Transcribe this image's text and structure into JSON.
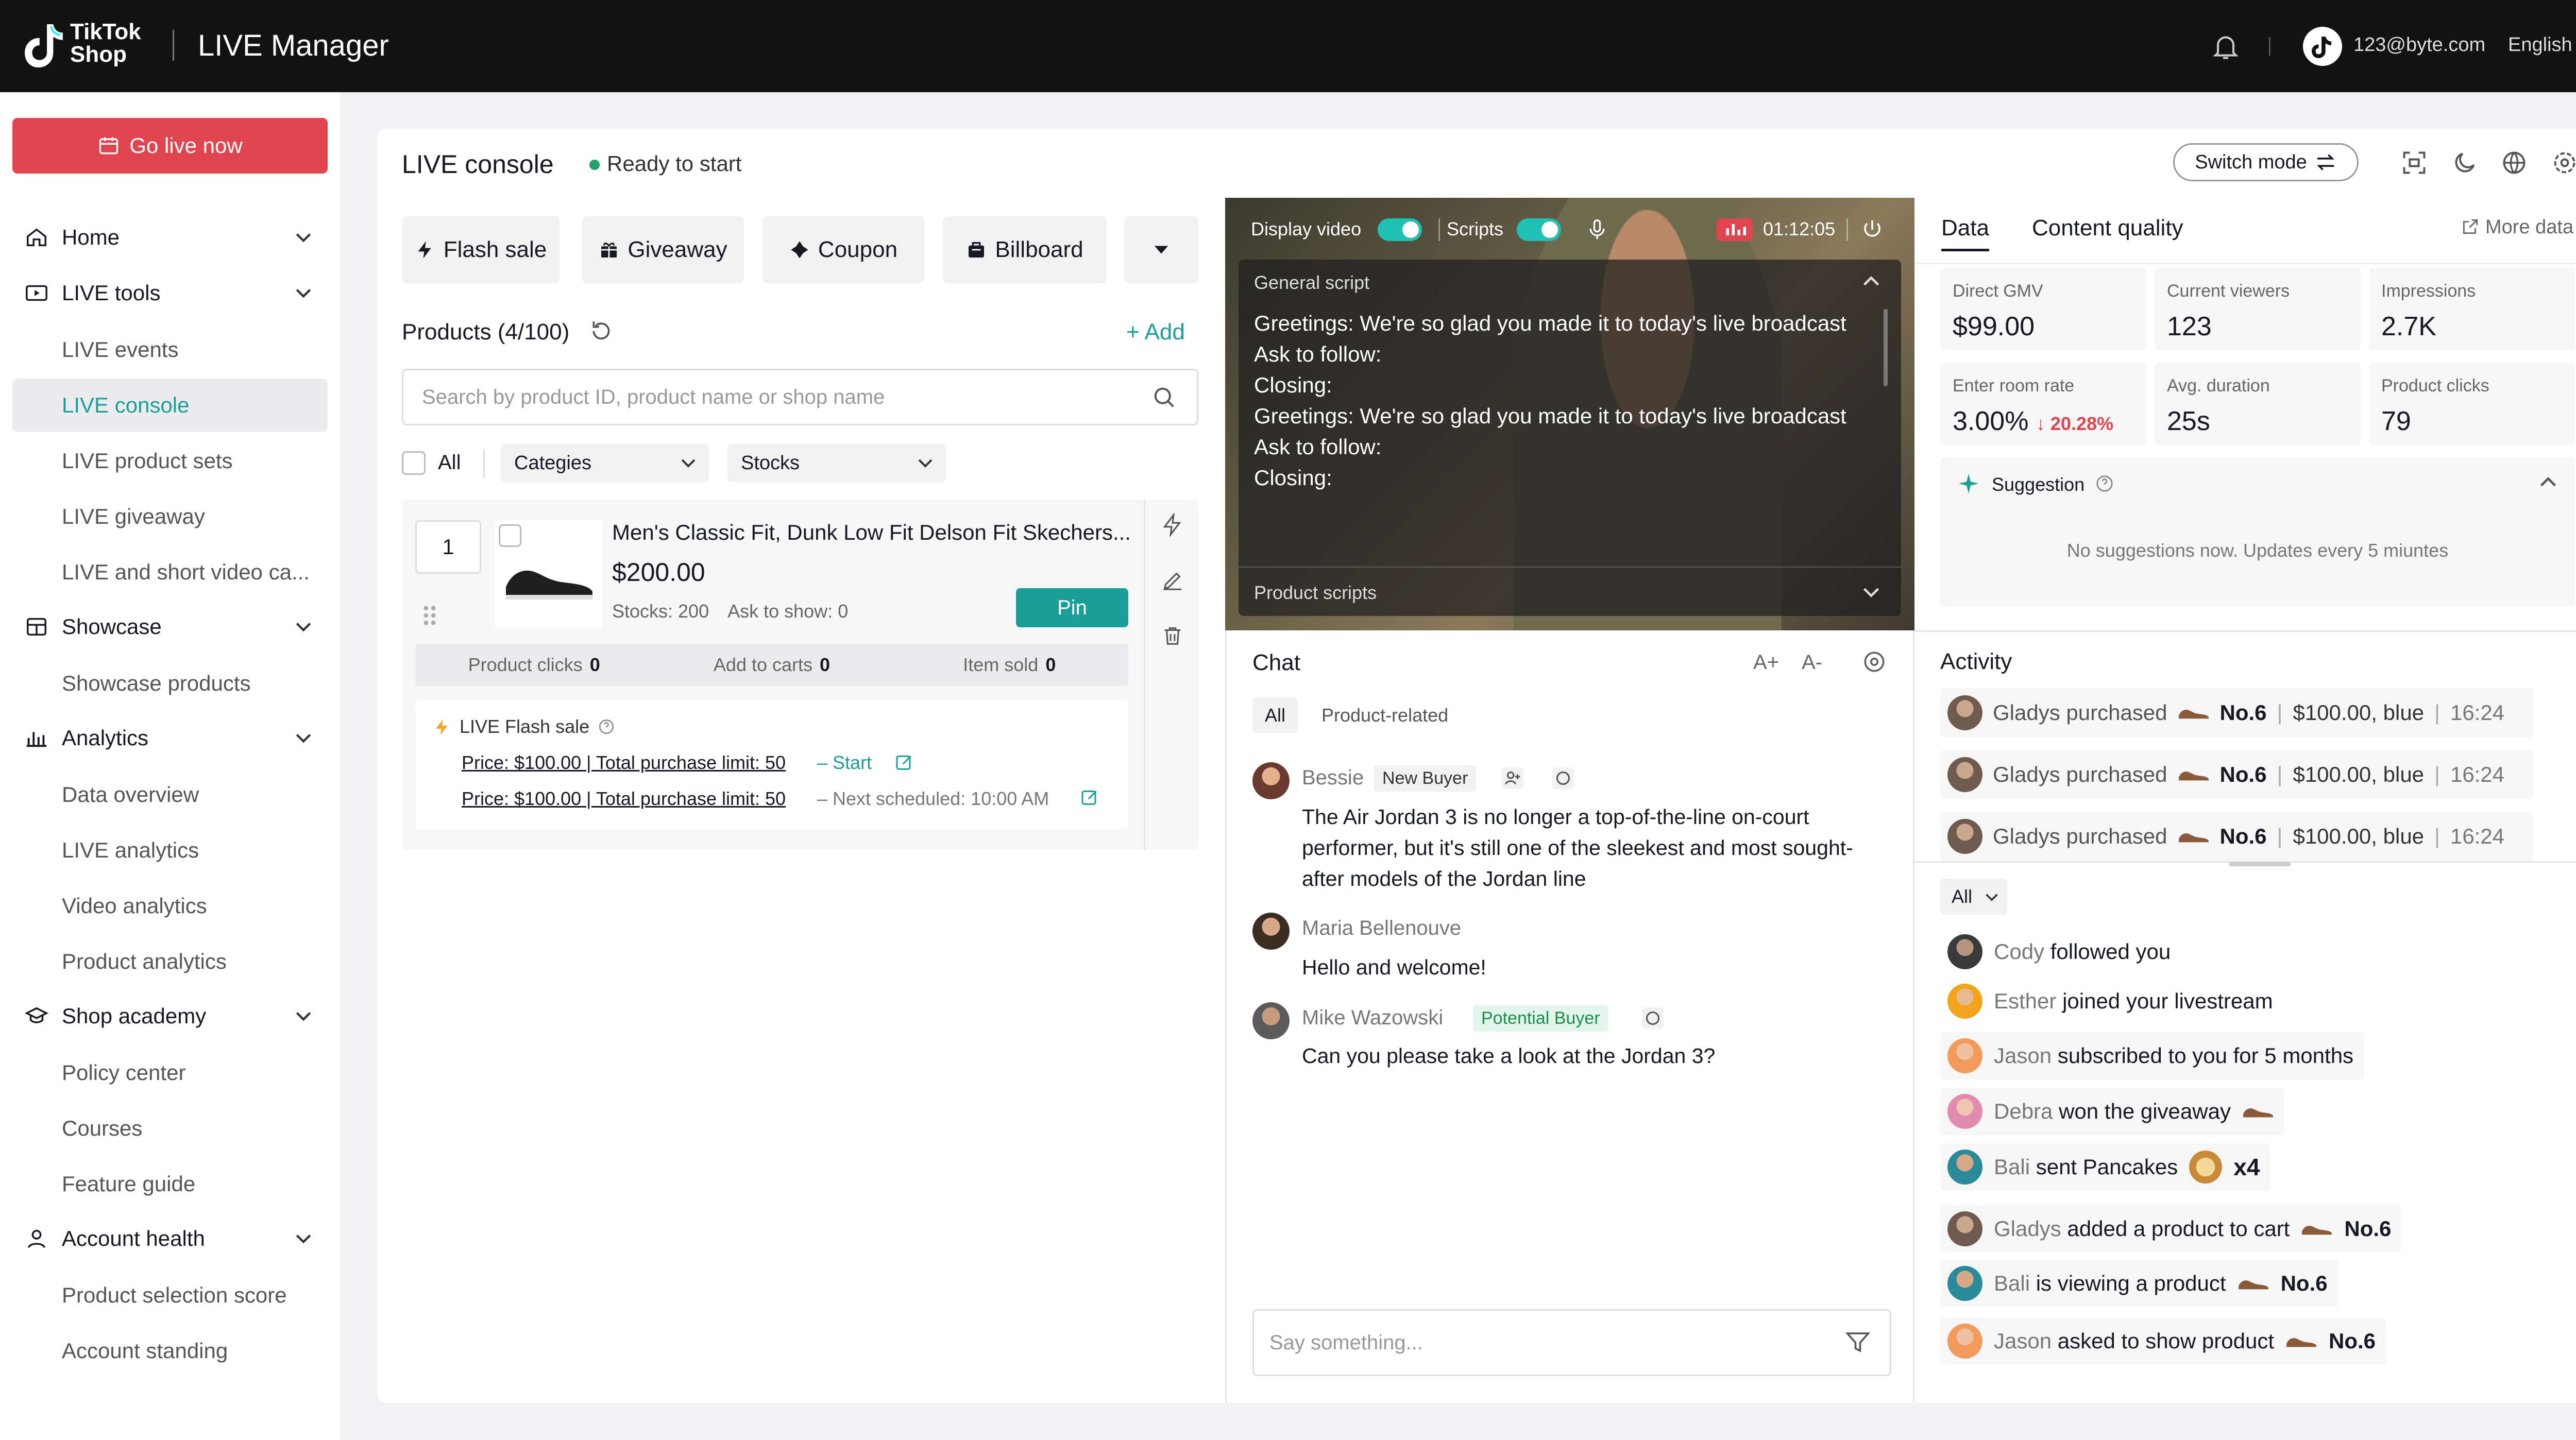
{
  "topbar": {
    "brand_line1": "TikTok",
    "brand_line2": "Shop",
    "app_title": "LIVE Manager",
    "email": "123@byte.com",
    "language": "English",
    "icons": [
      "bell-icon",
      "tiktok-avatar-icon",
      "chevron-down-icon"
    ]
  },
  "sidebar": {
    "go_live": "Go live now",
    "sections": [
      {
        "label": "Home",
        "icon": "home-icon"
      },
      {
        "label": "LIVE tools",
        "icon": "live-icon",
        "items": [
          "LIVE events",
          "LIVE console",
          "LIVE product sets",
          "LIVE giveaway",
          "LIVE and short video ca..."
        ]
      },
      {
        "label": "Showcase",
        "icon": "showcase-icon",
        "items": [
          "Showcase products"
        ]
      },
      {
        "label": "Analytics",
        "icon": "analytics-icon",
        "items": [
          "Data overview",
          "LIVE analytics",
          "Video analytics",
          "Product analytics"
        ]
      },
      {
        "label": "Shop academy",
        "icon": "academy-icon",
        "items": [
          "Policy center",
          "Courses",
          "Feature guide"
        ]
      },
      {
        "label": "Account health",
        "icon": "user-icon",
        "items": [
          "Product selection score",
          "Account standing"
        ]
      }
    ],
    "active_item": "LIVE console"
  },
  "console": {
    "title": "LIVE console",
    "status": "Ready to start",
    "switch_mode": "Switch mode",
    "actions": [
      "Flash sale",
      "Giveaway",
      "Coupon",
      "Billboard"
    ],
    "products_header": "Products (4/100)",
    "add_label": "Add",
    "search_placeholder": "Search by product ID, product name or shop name",
    "filter_all": "All",
    "filter_categories": "Categies",
    "filter_stocks": "Stocks",
    "product": {
      "qty": "1",
      "name": "Men's Classic Fit, Dunk Low Fit Delson Fit Skechers...",
      "price": "$200.00",
      "stocks": "Stocks: 200",
      "ask_to_show": "Ask to show: 0",
      "pin": "Pin",
      "clicks_label": "Product clicks",
      "clicks_value": "0",
      "carts_label": "Add to carts",
      "carts_value": "0",
      "sold_label": "Item sold",
      "sold_value": "0",
      "flash_title": "LIVE Flash sale",
      "flash_line1": "Price: $100.00 | Total purchase limit: 50",
      "flash_start": "Start",
      "flash_line2": "Price: $100.00 | Total purchase limit: 50",
      "flash_next": "Next scheduled: 10:00 AM"
    }
  },
  "video": {
    "display_video": "Display video",
    "scripts": "Scripts",
    "timer": "01:12:05",
    "general_script": "General script",
    "script_lines": [
      "Greetings: We're so glad you made it to today's live broadcast",
      "Ask to follow:",
      "Closing:",
      "Greetings: We're so glad you made it to today's live broadcast",
      "Ask to follow:",
      "Closing:"
    ],
    "product_scripts": "Product scripts"
  },
  "chat": {
    "title": "Chat",
    "font_up": "A+",
    "font_down": "A-",
    "tabs": [
      "All",
      "Product-related"
    ],
    "messages": [
      {
        "name": "Bessie",
        "tag": "New Buyer",
        "text": "The Air Jordan 3 is no longer a top-of-the-line on-court performer, but it's still one of the sleekest and most sought-after models of the Jordan line"
      },
      {
        "name": "Maria Bellenouve",
        "tag": "",
        "text": "Hello and welcome!"
      },
      {
        "name": "Mike Wazowski",
        "tag": "Potential Buyer",
        "text": "Can you please take a look at the Jordan 3?"
      }
    ],
    "input_placeholder": "Say something..."
  },
  "data_panel": {
    "tabs": [
      "Data",
      "Content quality"
    ],
    "more_data": "More data",
    "stats": [
      {
        "label": "Direct GMV",
        "value": "$99.00"
      },
      {
        "label": "Current viewers",
        "value": "123"
      },
      {
        "label": "Impressions",
        "value": "2.7K"
      },
      {
        "label": "Enter room rate",
        "value": "3.00%",
        "delta": "20.28%"
      },
      {
        "label": "Avg. duration",
        "value": "25s"
      },
      {
        "label": "Product clicks",
        "value": "79"
      }
    ],
    "suggestion_title": "Suggestion",
    "suggestion_text": "No suggestions now. Updates every 5 miuntes"
  },
  "activity": {
    "title": "Activity",
    "purchases": [
      {
        "who": "Gladys purchased",
        "no": "No.6",
        "detail": "$100.00, blue",
        "time": "16:24"
      },
      {
        "who": "Gladys purchased",
        "no": "No.6",
        "detail": "$100.00, blue",
        "time": "16:24"
      },
      {
        "who": "Gladys purchased",
        "no": "No.6",
        "detail": "$100.00, blue",
        "time": "16:24"
      }
    ],
    "filter": "All",
    "feed": [
      {
        "name": "Cody",
        "text": "followed you"
      },
      {
        "name": "Esther",
        "text": "joined your livestream"
      },
      {
        "name": "Jason",
        "text": "subscribed to you for 5 months"
      },
      {
        "name": "Debra",
        "text": "won the giveaway"
      },
      {
        "name": "Bali",
        "text": "sent Pancakes",
        "extra": "x4"
      },
      {
        "name": "Gladys",
        "text": "added a product to cart",
        "extra": "No.6"
      },
      {
        "name": "Bali",
        "text": "is viewing a product",
        "extra": "No.6"
      },
      {
        "name": "Jason",
        "text": "asked to show product",
        "extra": "No.6"
      }
    ]
  },
  "colors": {
    "accent": "#1a9e97",
    "golive": "#e0454f",
    "topbar": "#121212"
  }
}
